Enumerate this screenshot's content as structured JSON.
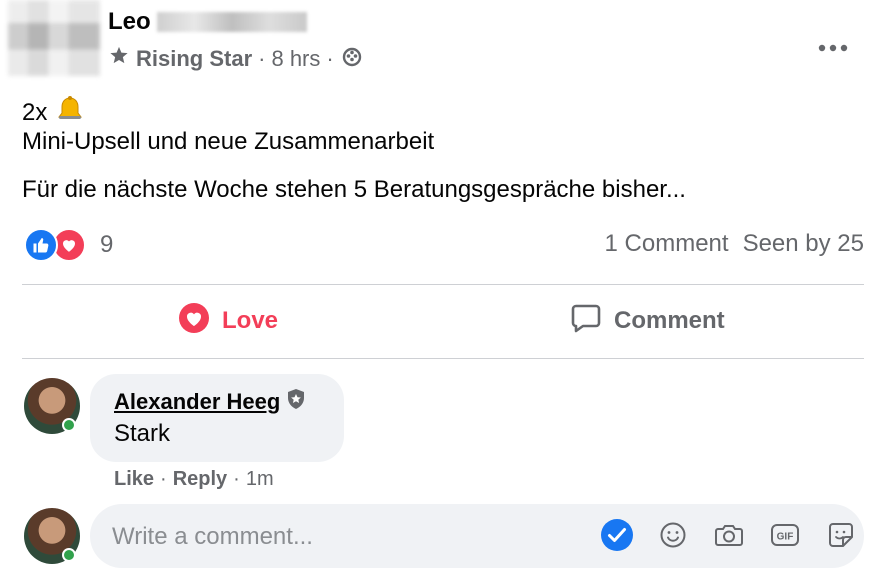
{
  "post": {
    "author_visible": "Leo",
    "badge": "Rising Star",
    "time": "8 hrs",
    "sep": "·",
    "line1_text": "2x",
    "line2": "Mini-Upsell und neue Zusammenarbeit",
    "line3": "Für die nächste Woche stehen 5 Beratungsgespräche bisher..."
  },
  "reactions": {
    "count": "9"
  },
  "stats": {
    "comments": "1 Comment",
    "seen": "Seen by 25"
  },
  "actions": {
    "love_label": "Love",
    "comment_label": "Comment"
  },
  "comment": {
    "author": "Alexander Heeg",
    "text": "Stark",
    "like": "Like",
    "reply": "Reply",
    "time": "1m",
    "sep": "·"
  },
  "composer": {
    "placeholder": "Write a comment..."
  },
  "colors": {
    "love": "#f33e58",
    "like": "#1877f2",
    "muted": "#65676b",
    "bubble": "#f0f2f5"
  }
}
